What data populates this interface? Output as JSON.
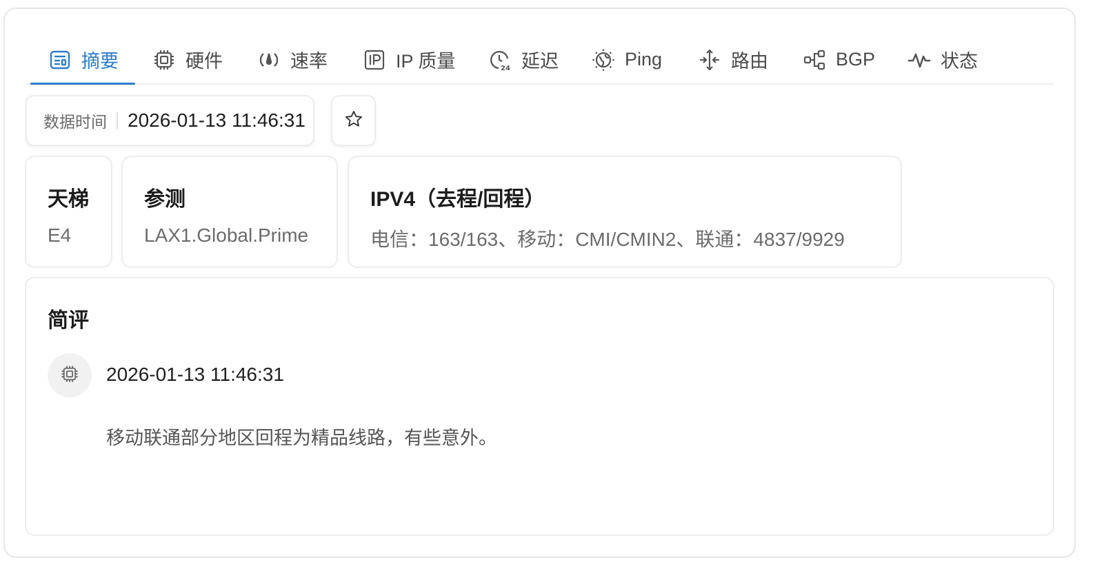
{
  "tabs": [
    {
      "label": "摘要",
      "icon": "summary-icon",
      "active": true
    },
    {
      "label": "硬件",
      "icon": "chip-icon",
      "active": false
    },
    {
      "label": "速率",
      "icon": "speed-icon",
      "active": false
    },
    {
      "label": "IP 质量",
      "icon": "ip-icon",
      "active": false
    },
    {
      "label": "延迟",
      "icon": "latency-clock-icon",
      "active": false
    },
    {
      "label": "Ping",
      "icon": "globe-icon",
      "active": false
    },
    {
      "label": "路由",
      "icon": "route-icon",
      "active": false
    },
    {
      "label": "BGP",
      "icon": "bgp-icon",
      "active": false
    },
    {
      "label": "状态",
      "icon": "pulse-icon",
      "active": false
    }
  ],
  "data_time": {
    "label": "数据时间",
    "value": "2026-01-13 11:46:31"
  },
  "star_icon": "star-icon",
  "cards": [
    {
      "title": "天梯",
      "value": "E4"
    },
    {
      "title": "参测",
      "value": "LAX1.Global.Prime"
    },
    {
      "title": "IPV4（去程/回程）",
      "value": "电信：163/163、移动：CMI/CMIN2、联通：4837/9929"
    }
  ],
  "review": {
    "title": "简评",
    "avatar_icon": "chip-icon",
    "time": "2026-01-13 11:46:31",
    "text": "移动联通部分地区回程为精品线路，有些意外。"
  },
  "colors": {
    "accent": "#2e7bc9",
    "border": "#ececec",
    "muted": "#6b6b6b"
  }
}
